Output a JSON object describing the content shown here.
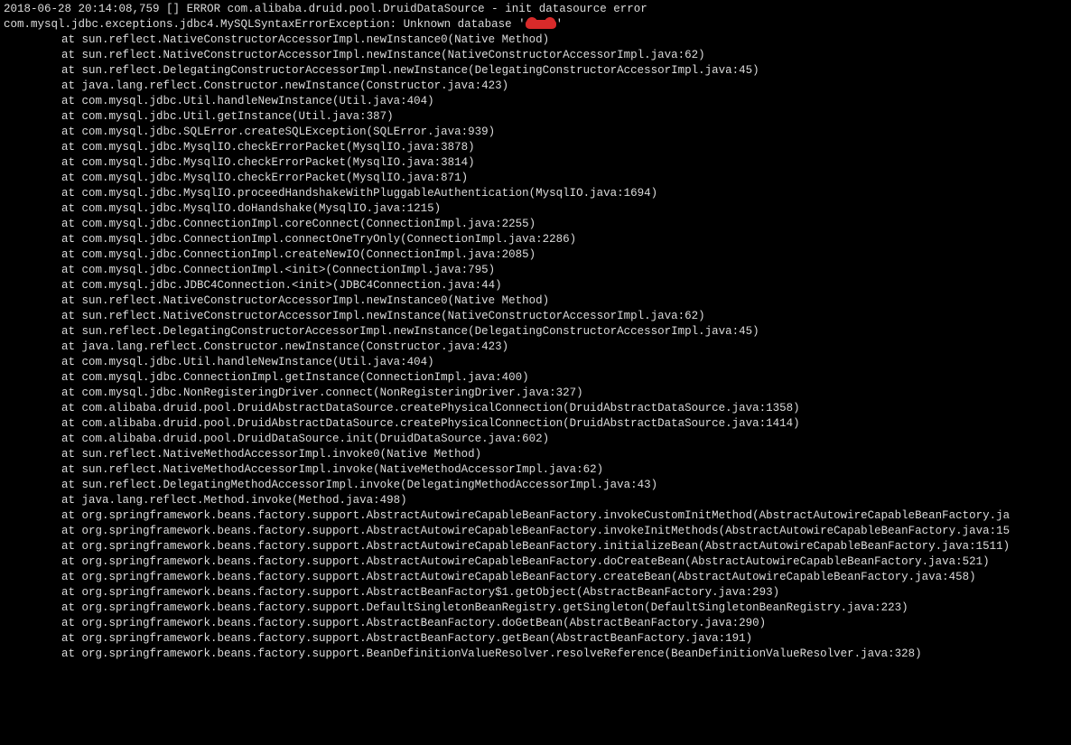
{
  "header": {
    "timestamp": "2018-06-28 20:14:08,759",
    "thread": "[]",
    "level": "ERROR",
    "logger": "com.alibaba.druid.pool.DruidDataSource",
    "sep": "-",
    "message": "init datasource error"
  },
  "exception": {
    "class": "com.mysql.jdbc.exceptions.jdbc4.MySQLSyntaxErrorException",
    "message_prefix": "Unknown database '",
    "message_suffix": "'"
  },
  "stack_prefix": "at ",
  "stack": [
    "sun.reflect.NativeConstructorAccessorImpl.newInstance0(Native Method)",
    "sun.reflect.NativeConstructorAccessorImpl.newInstance(NativeConstructorAccessorImpl.java:62)",
    "sun.reflect.DelegatingConstructorAccessorImpl.newInstance(DelegatingConstructorAccessorImpl.java:45)",
    "java.lang.reflect.Constructor.newInstance(Constructor.java:423)",
    "com.mysql.jdbc.Util.handleNewInstance(Util.java:404)",
    "com.mysql.jdbc.Util.getInstance(Util.java:387)",
    "com.mysql.jdbc.SQLError.createSQLException(SQLError.java:939)",
    "com.mysql.jdbc.MysqlIO.checkErrorPacket(MysqlIO.java:3878)",
    "com.mysql.jdbc.MysqlIO.checkErrorPacket(MysqlIO.java:3814)",
    "com.mysql.jdbc.MysqlIO.checkErrorPacket(MysqlIO.java:871)",
    "com.mysql.jdbc.MysqlIO.proceedHandshakeWithPluggableAuthentication(MysqlIO.java:1694)",
    "com.mysql.jdbc.MysqlIO.doHandshake(MysqlIO.java:1215)",
    "com.mysql.jdbc.ConnectionImpl.coreConnect(ConnectionImpl.java:2255)",
    "com.mysql.jdbc.ConnectionImpl.connectOneTryOnly(ConnectionImpl.java:2286)",
    "com.mysql.jdbc.ConnectionImpl.createNewIO(ConnectionImpl.java:2085)",
    "com.mysql.jdbc.ConnectionImpl.<init>(ConnectionImpl.java:795)",
    "com.mysql.jdbc.JDBC4Connection.<init>(JDBC4Connection.java:44)",
    "sun.reflect.NativeConstructorAccessorImpl.newInstance0(Native Method)",
    "sun.reflect.NativeConstructorAccessorImpl.newInstance(NativeConstructorAccessorImpl.java:62)",
    "sun.reflect.DelegatingConstructorAccessorImpl.newInstance(DelegatingConstructorAccessorImpl.java:45)",
    "java.lang.reflect.Constructor.newInstance(Constructor.java:423)",
    "com.mysql.jdbc.Util.handleNewInstance(Util.java:404)",
    "com.mysql.jdbc.ConnectionImpl.getInstance(ConnectionImpl.java:400)",
    "com.mysql.jdbc.NonRegisteringDriver.connect(NonRegisteringDriver.java:327)",
    "com.alibaba.druid.pool.DruidAbstractDataSource.createPhysicalConnection(DruidAbstractDataSource.java:1358)",
    "com.alibaba.druid.pool.DruidAbstractDataSource.createPhysicalConnection(DruidAbstractDataSource.java:1414)",
    "com.alibaba.druid.pool.DruidDataSource.init(DruidDataSource.java:602)",
    "sun.reflect.NativeMethodAccessorImpl.invoke0(Native Method)",
    "sun.reflect.NativeMethodAccessorImpl.invoke(NativeMethodAccessorImpl.java:62)",
    "sun.reflect.DelegatingMethodAccessorImpl.invoke(DelegatingMethodAccessorImpl.java:43)",
    "java.lang.reflect.Method.invoke(Method.java:498)",
    "org.springframework.beans.factory.support.AbstractAutowireCapableBeanFactory.invokeCustomInitMethod(AbstractAutowireCapableBeanFactory.ja",
    "org.springframework.beans.factory.support.AbstractAutowireCapableBeanFactory.invokeInitMethods(AbstractAutowireCapableBeanFactory.java:15",
    "org.springframework.beans.factory.support.AbstractAutowireCapableBeanFactory.initializeBean(AbstractAutowireCapableBeanFactory.java:1511)",
    "org.springframework.beans.factory.support.AbstractAutowireCapableBeanFactory.doCreateBean(AbstractAutowireCapableBeanFactory.java:521)",
    "org.springframework.beans.factory.support.AbstractAutowireCapableBeanFactory.createBean(AbstractAutowireCapableBeanFactory.java:458)",
    "org.springframework.beans.factory.support.AbstractBeanFactory$1.getObject(AbstractBeanFactory.java:293)",
    "org.springframework.beans.factory.support.DefaultSingletonBeanRegistry.getSingleton(DefaultSingletonBeanRegistry.java:223)",
    "org.springframework.beans.factory.support.AbstractBeanFactory.doGetBean(AbstractBeanFactory.java:290)",
    "org.springframework.beans.factory.support.AbstractBeanFactory.getBean(AbstractBeanFactory.java:191)",
    "org.springframework.beans.factory.support.BeanDefinitionValueResolver.resolveReference(BeanDefinitionValueResolver.java:328)"
  ]
}
